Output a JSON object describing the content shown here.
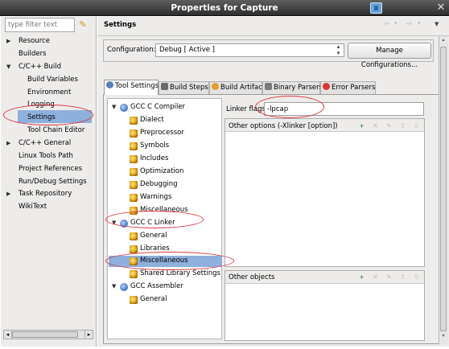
{
  "window": {
    "title": "Properties for Capture"
  },
  "left": {
    "filter_placeholder": "type filter text",
    "tree": [
      {
        "label": "Resource",
        "expand": "▶"
      },
      {
        "label": "Builders"
      },
      {
        "label": "C/C++ Build",
        "expand": "▼"
      },
      {
        "label": "Build Variables"
      },
      {
        "label": "Environment"
      },
      {
        "label": "Logging"
      },
      {
        "label": "Settings"
      },
      {
        "label": "Tool Chain Editor"
      },
      {
        "label": "C/C++ General",
        "expand": "▶"
      },
      {
        "label": "Linux Tools Path"
      },
      {
        "label": "Project References"
      },
      {
        "label": "Run/Debug Settings"
      },
      {
        "label": "Task Repository",
        "expand": "▶"
      },
      {
        "label": "WikiText"
      }
    ]
  },
  "header": {
    "title": "Settings",
    "back": "⇦",
    "forward": "⇨",
    "dropdown": "▾",
    "menu": "▼"
  },
  "config": {
    "label": "Configuration:",
    "value": "Debug  [ Active ]",
    "arrow": "⌃⌄",
    "manage_label": "Manage Configurations..."
  },
  "tabs": [
    {
      "label": "Tool Settings",
      "color": "#5a7fbf"
    },
    {
      "label": "Build Steps",
      "color": "#e0a02a"
    },
    {
      "label": "Build Artifact",
      "color": "#e0a02a"
    },
    {
      "label": "Binary Parsers",
      "color": "#7a7a7a"
    },
    {
      "label": "Error Parsers",
      "color": "#d33"
    }
  ],
  "tool_tree": {
    "items": [
      {
        "label": "GCC C Compiler",
        "expand": "▼"
      },
      {
        "label": "Dialect"
      },
      {
        "label": "Preprocessor"
      },
      {
        "label": "Symbols"
      },
      {
        "label": "Includes"
      },
      {
        "label": "Optimization"
      },
      {
        "label": "Debugging"
      },
      {
        "label": "Warnings"
      },
      {
        "label": "Miscellaneous"
      },
      {
        "label": "GCC C Linker",
        "expand": "▼"
      },
      {
        "label": "General"
      },
      {
        "label": "Libraries"
      },
      {
        "label": "Miscellaneous"
      },
      {
        "label": "Shared Library Settings"
      },
      {
        "label": "GCC Assembler",
        "expand": "▼"
      },
      {
        "label": "General"
      }
    ]
  },
  "linker": {
    "label": "Linker flags",
    "value": "-lpcap"
  },
  "other_options": {
    "title": "Other options (-Xlinker [option])"
  },
  "other_objects": {
    "title": "Other objects"
  },
  "list_toolbar": {
    "add": "+",
    "delete": "✕",
    "edit": "✎",
    "up": "⇧",
    "down": "⇩"
  },
  "scroll": {
    "left": "◂",
    "right": "▸",
    "up": "▴",
    "down": "▾"
  },
  "colors": {
    "selection": "#8eb0dc",
    "annotation": "#d9343b"
  }
}
